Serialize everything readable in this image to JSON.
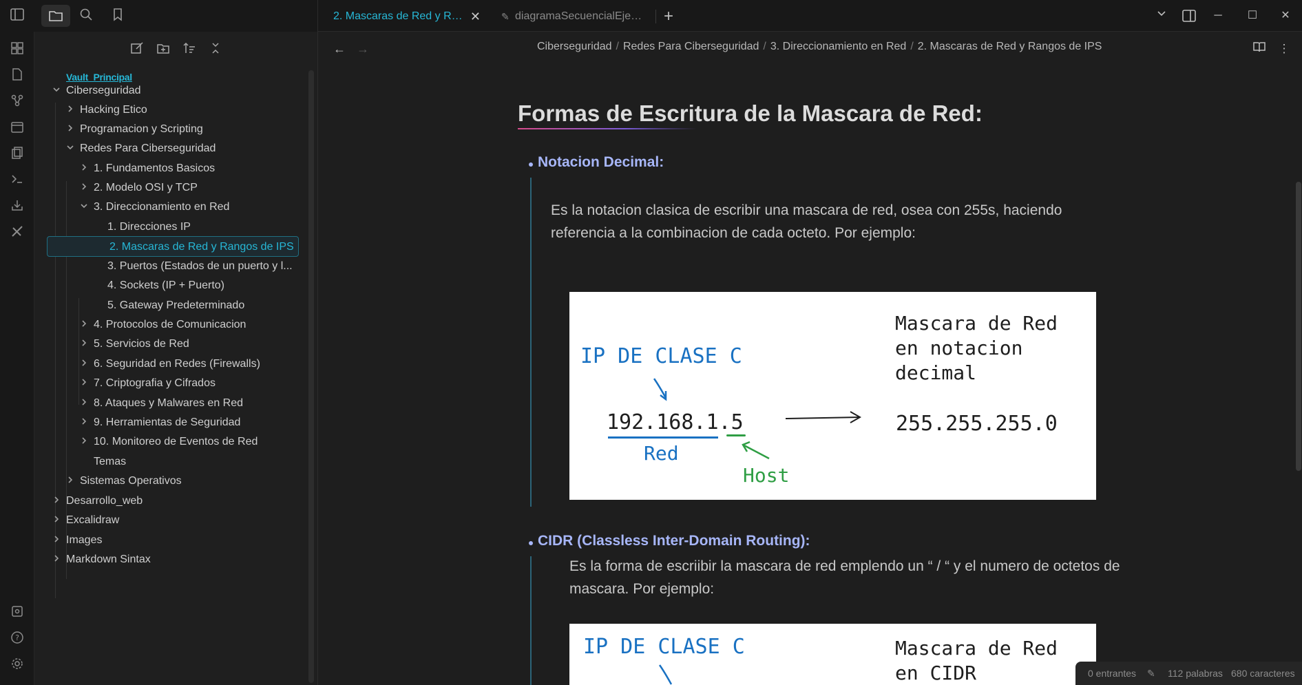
{
  "tabs": {
    "active_label": "2. Mascaras de Red y Ra...",
    "inactive_label": "diagramaSecuencialEjem..."
  },
  "vault_name": "Vault_Principal",
  "tree": [
    {
      "label": "Ciberseguridad",
      "expanded": true
    },
    {
      "label": "Hacking Etico"
    },
    {
      "label": "Programacion y Scripting"
    },
    {
      "label": "Redes Para Ciberseguridad",
      "expanded": true
    },
    {
      "label": "1. Fundamentos Basicos"
    },
    {
      "label": "2. Modelo OSI y TCP"
    },
    {
      "label": "3. Direccionamiento en Red",
      "expanded": true
    },
    {
      "label": "1. Direcciones IP"
    },
    {
      "label": "2. Mascaras de Red y Rangos de IPS",
      "selected": true
    },
    {
      "label": "3. Puertos (Estados de un puerto y l..."
    },
    {
      "label": "4. Sockets (IP + Puerto)"
    },
    {
      "label": "5. Gateway Predeterminado"
    },
    {
      "label": "4. Protocolos de Comunicacion"
    },
    {
      "label": "5. Servicios de Red"
    },
    {
      "label": "6. Seguridad en Redes (Firewalls)"
    },
    {
      "label": "7. Criptografia y Cifrados"
    },
    {
      "label": "8. Ataques y Malwares en Red"
    },
    {
      "label": "9. Herramientas de Seguridad"
    },
    {
      "label": "10. Monitoreo de Eventos de Red"
    },
    {
      "label": "Temas"
    },
    {
      "label": "Sistemas Operativos"
    },
    {
      "label": "Desarrollo_web"
    },
    {
      "label": "Excalidraw"
    },
    {
      "label": "Images"
    },
    {
      "label": "Markdown Sintax"
    }
  ],
  "breadcrumb": {
    "b1": "Ciberseguridad",
    "b2": "Redes Para Ciberseguridad",
    "b3": "3. Direccionamiento en Red",
    "b4": "2. Mascaras de Red y Rangos de IPS",
    "sep": "/"
  },
  "content": {
    "heading": "Formas de Escritura de la Mascara de Red:",
    "section1_title": "Notacion Decimal:",
    "section1_text": "Es la notacion clasica de escribir una mascara de red, osea con 255s, haciendo referencia a la combinacion de cada octeto. Por ejemplo:",
    "section2_title": "CIDR (Classless Inter-Domain Routing):",
    "section2_text": "Es la forma de escriibir la mascara de red emplendo un “ / “ y el numero de octetos de mascara. Por ejemplo:"
  },
  "figure1": {
    "class_label": "IP DE CLASE C",
    "ip": "192.168.1.5",
    "red_label": "Red",
    "host_label": "Host",
    "mask_title_l1": "Mascara de Red",
    "mask_title_l2": "en notacion",
    "mask_title_l3": "decimal",
    "mask_value": "255.255.255.0"
  },
  "figure2": {
    "class_label": "IP DE CLASE C",
    "mask_title_l1": "Mascara de Red",
    "mask_title_l2": "en CIDR"
  },
  "status": {
    "backlinks": "0 entrantes",
    "words": "112 palabras",
    "chars": "680 caracteres"
  },
  "colors": {
    "accent": "#27b7d6",
    "heading_blue": "#a7b6f8",
    "figure_blue": "#1971c2",
    "figure_green": "#2f9e44"
  }
}
